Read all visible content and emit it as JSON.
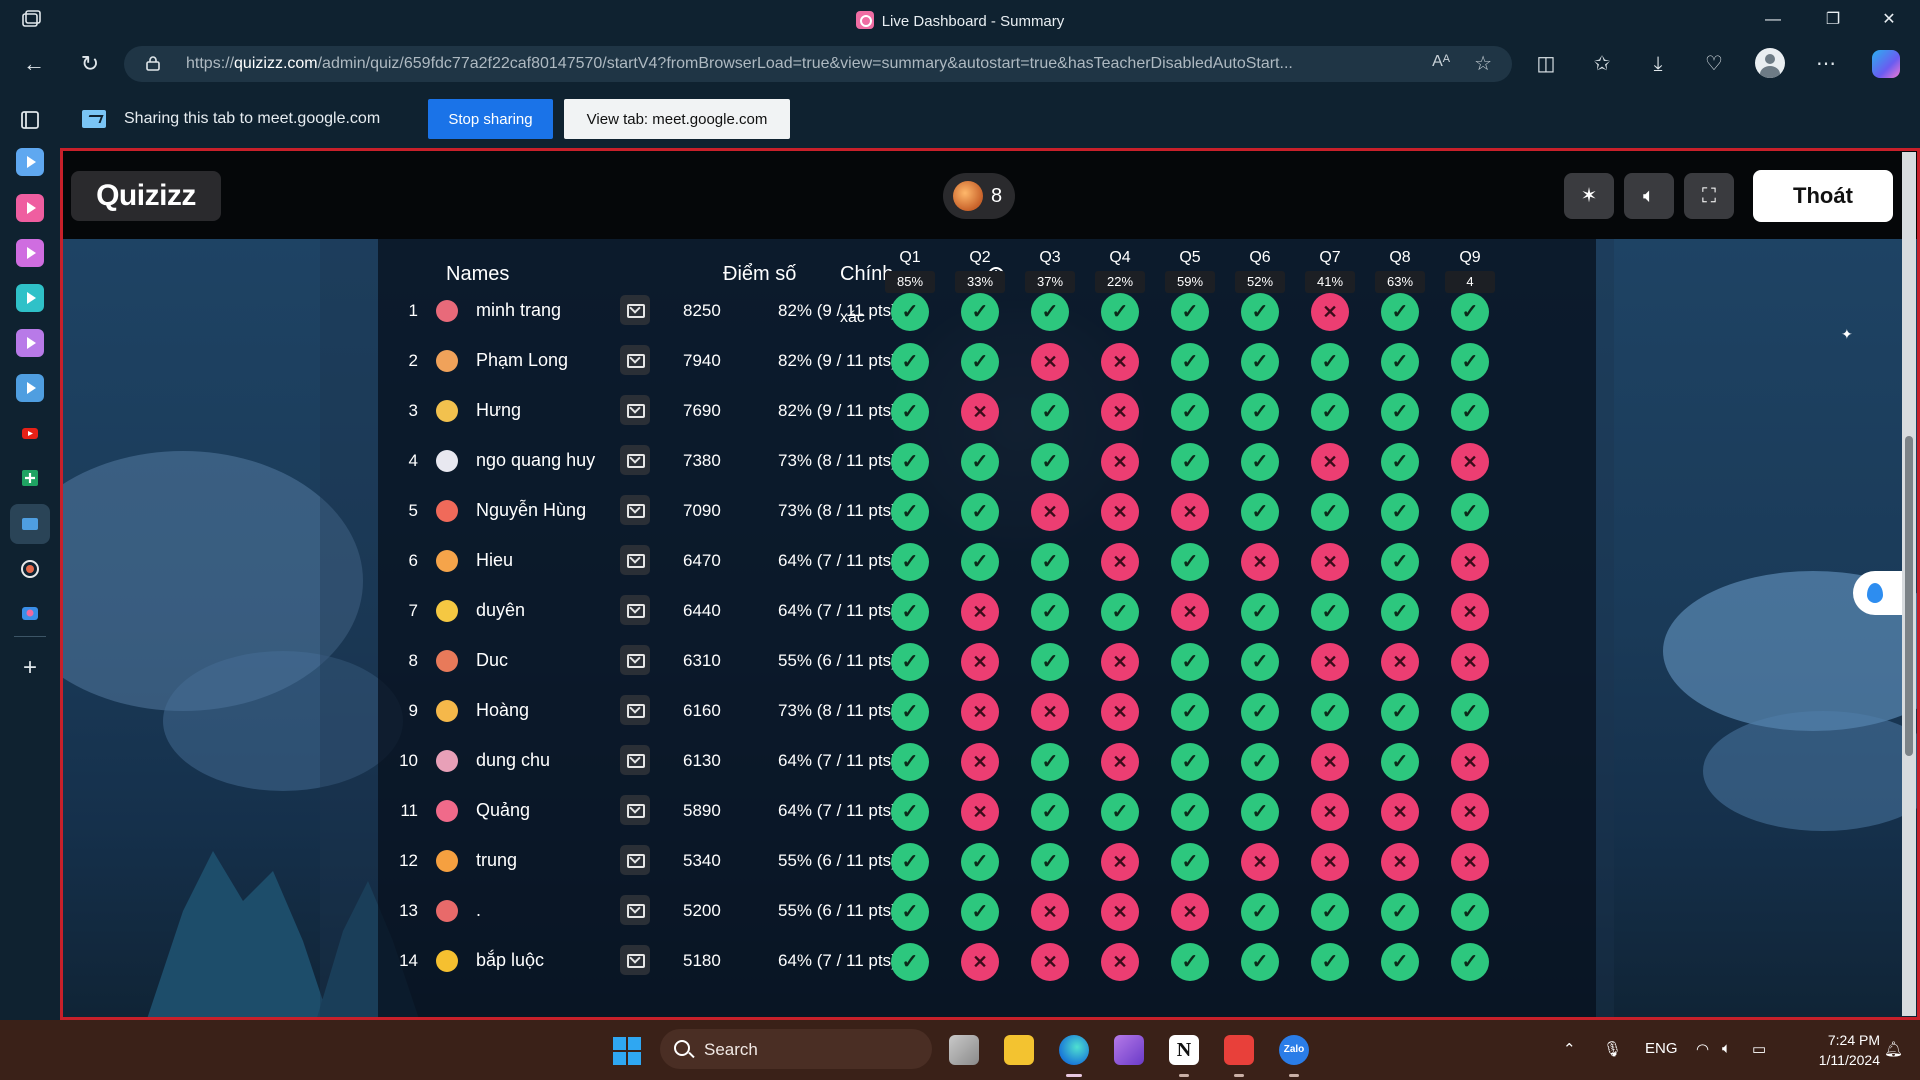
{
  "window": {
    "tab_title": "Live Dashboard - Summary",
    "controls": {
      "minimize": "—",
      "restore": "❐",
      "close": "✕"
    }
  },
  "address_bar": {
    "url_prefix": "https://",
    "url_host": "quizizz.com",
    "url_path": "/admin/quiz/659fdc77a2f22caf80147570/startV4?fromBrowserLoad=true&view=summary&autostart=true&hasTeacherDisabledAutoStart...",
    "read_aloud": "Aᴬ"
  },
  "sharing_bar": {
    "message": "Sharing this tab to meet.google.com",
    "stop_label": "Stop sharing",
    "view_label": "View tab: meet.google.com"
  },
  "quiz_header": {
    "logo": "Quizizz",
    "player_count": "8",
    "exit_label": "Thoát"
  },
  "table": {
    "col_names": "Names",
    "col_score": "Điểm số",
    "col_accuracy": "Chính",
    "col_accuracy_wrap": "xác",
    "info_glyph": "i",
    "questions": [
      {
        "label": "Q1",
        "pct": "85%"
      },
      {
        "label": "Q2",
        "pct": "33%"
      },
      {
        "label": "Q3",
        "pct": "37%"
      },
      {
        "label": "Q4",
        "pct": "22%"
      },
      {
        "label": "Q5",
        "pct": "59%"
      },
      {
        "label": "Q6",
        "pct": "52%"
      },
      {
        "label": "Q7",
        "pct": "41%"
      },
      {
        "label": "Q8",
        "pct": "63%"
      },
      {
        "label": "Q9",
        "pct": "4"
      }
    ],
    "rows": [
      {
        "rank": "1",
        "name": "minh trang",
        "score": "8250",
        "accuracy": "82% (9 / 11 pts)",
        "answers": [
          1,
          1,
          1,
          1,
          1,
          1,
          0,
          1,
          1
        ]
      },
      {
        "rank": "2",
        "name": "Phạm Long",
        "score": "7940",
        "accuracy": "82% (9 / 11 pts)",
        "answers": [
          1,
          1,
          0,
          0,
          1,
          1,
          1,
          1,
          1
        ]
      },
      {
        "rank": "3",
        "name": "Hưng",
        "score": "7690",
        "accuracy": "82% (9 / 11 pts)",
        "answers": [
          1,
          0,
          1,
          0,
          1,
          1,
          1,
          1,
          1
        ]
      },
      {
        "rank": "4",
        "name": "ngo quang huy",
        "score": "7380",
        "accuracy": "73% (8 / 11 pts)",
        "answers": [
          1,
          1,
          1,
          0,
          1,
          1,
          0,
          1,
          0
        ]
      },
      {
        "rank": "5",
        "name": "Nguyễn Hùng",
        "score": "7090",
        "accuracy": "73% (8 / 11 pts)",
        "answers": [
          1,
          1,
          0,
          0,
          0,
          1,
          1,
          1,
          1
        ]
      },
      {
        "rank": "6",
        "name": "Hieu",
        "score": "6470",
        "accuracy": "64% (7 / 11 pts)",
        "answers": [
          1,
          1,
          1,
          0,
          1,
          0,
          0,
          1,
          0
        ]
      },
      {
        "rank": "7",
        "name": "duyên",
        "score": "6440",
        "accuracy": "64% (7 / 11 pts)",
        "answers": [
          1,
          0,
          1,
          1,
          0,
          1,
          1,
          1,
          0
        ]
      },
      {
        "rank": "8",
        "name": "Duc",
        "score": "6310",
        "accuracy": "55% (6 / 11 pts)",
        "answers": [
          1,
          0,
          1,
          0,
          1,
          1,
          0,
          0,
          0
        ]
      },
      {
        "rank": "9",
        "name": "Hoàng",
        "score": "6160",
        "accuracy": "73% (8 / 11 pts)",
        "answers": [
          1,
          0,
          0,
          0,
          1,
          1,
          1,
          1,
          1
        ]
      },
      {
        "rank": "10",
        "name": "dung chu",
        "score": "6130",
        "accuracy": "64% (7 / 11 pts)",
        "answers": [
          1,
          0,
          1,
          0,
          1,
          1,
          0,
          1,
          0
        ]
      },
      {
        "rank": "11",
        "name": "Quảng",
        "score": "5890",
        "accuracy": "64% (7 / 11 pts)",
        "answers": [
          1,
          0,
          1,
          1,
          1,
          1,
          0,
          0,
          0
        ]
      },
      {
        "rank": "12",
        "name": "trung",
        "score": "5340",
        "accuracy": "55% (6 / 11 pts)",
        "answers": [
          1,
          1,
          1,
          0,
          1,
          0,
          0,
          0,
          0
        ]
      },
      {
        "rank": "13",
        "name": ".",
        "score": "5200",
        "accuracy": "55% (6 / 11 pts)",
        "answers": [
          1,
          1,
          0,
          0,
          0,
          1,
          1,
          1,
          1
        ]
      },
      {
        "rank": "14",
        "name": "bắp luộc",
        "score": "5180",
        "accuracy": "64% (7 / 11 pts)",
        "answers": [
          1,
          0,
          0,
          0,
          1,
          1,
          1,
          1,
          1
        ]
      }
    ],
    "avatar_colors": [
      "#e86a7a",
      "#f0a25a",
      "#f2c14e",
      "#e8e8f0",
      "#f06a5a",
      "#f5a44a",
      "#f5c842",
      "#e87a5a",
      "#f5b84a",
      "#e8a0b8",
      "#f06a8a",
      "#f5a040",
      "#e86a6a",
      "#f5c030"
    ],
    "ok_glyph": "✓",
    "bad_glyph": "✕"
  },
  "taskbar": {
    "search_label": "Search",
    "lang": "ENG",
    "time": "7:24 PM",
    "date": "1/11/2024"
  },
  "colors": {
    "correct": "#2dc77e",
    "incorrect": "#ec3e72",
    "accent": "#1a73e8"
  }
}
